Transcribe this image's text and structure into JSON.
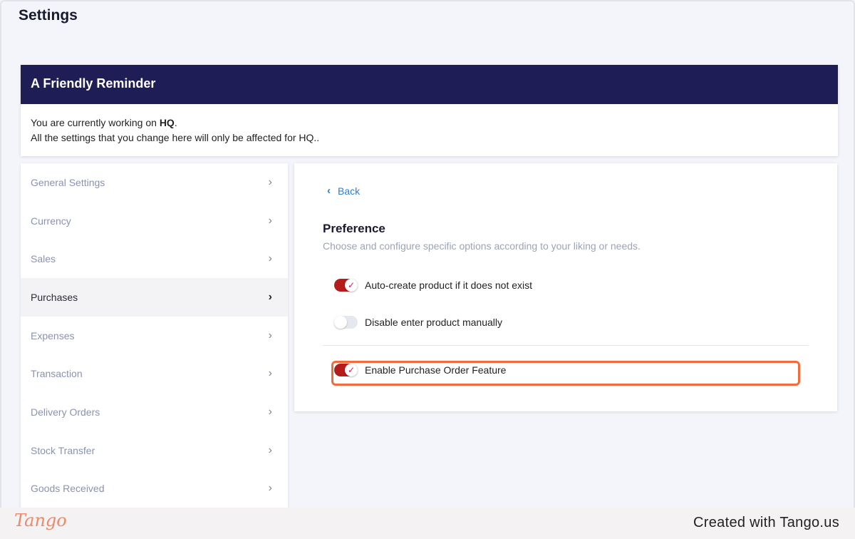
{
  "page": {
    "title": "Settings"
  },
  "reminder": {
    "heading": "A Friendly Reminder",
    "line1_prefix": "You are currently working on ",
    "line1_bold": "HQ",
    "line1_suffix": ".",
    "line2": "All the settings that you change here will only be affected for HQ.."
  },
  "sidebar": {
    "items": [
      {
        "label": "General Settings"
      },
      {
        "label": "Currency"
      },
      {
        "label": "Sales"
      },
      {
        "label": "Purchases"
      },
      {
        "label": "Expenses"
      },
      {
        "label": "Transaction"
      },
      {
        "label": "Delivery Orders"
      },
      {
        "label": "Stock Transfer"
      },
      {
        "label": "Goods Received"
      }
    ],
    "active_item": "Purchases"
  },
  "content": {
    "back_label": "Back",
    "section_title": "Preference",
    "section_subtitle": "Choose and configure specific options according to your liking or needs.",
    "options": [
      {
        "label": "Auto-create product if it does not exist",
        "enabled": true
      },
      {
        "label": "Disable enter product manually",
        "enabled": false
      },
      {
        "label": "Enable Purchase Order Feature",
        "enabled": true
      }
    ]
  },
  "footer": {
    "logo_text": "Tango",
    "credit": "Created with Tango.us"
  },
  "colors": {
    "header_bg": "#1f1d55",
    "toggle_on": "#b71c1c",
    "highlight": "#f26b3a",
    "link": "#2b7fd4"
  },
  "icons": {
    "chevron_right": "chevron-right-icon",
    "chevron_left": "chevron-left-icon",
    "check": "check-icon"
  }
}
